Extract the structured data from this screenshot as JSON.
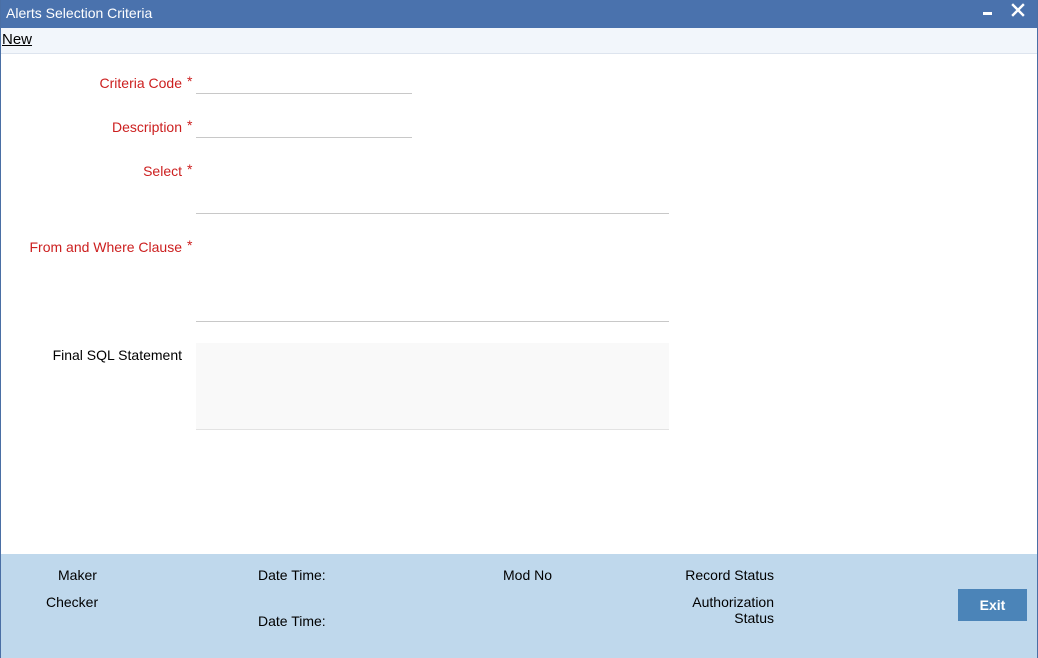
{
  "window": {
    "title": "Alerts Selection Criteria"
  },
  "toolbar": {
    "new_label": "New"
  },
  "form": {
    "criteria_code": {
      "label": "Criteria Code",
      "required_mark": "*",
      "value": ""
    },
    "description": {
      "label": "Description",
      "required_mark": "*",
      "value": ""
    },
    "select": {
      "label": "Select",
      "required_mark": "*",
      "value": ""
    },
    "from_where": {
      "label": "From and Where Clause",
      "required_mark": "*",
      "value": ""
    },
    "final_sql": {
      "label": "Final SQL Statement",
      "value": ""
    }
  },
  "footer": {
    "maker_label": "Maker",
    "checker_label": "Checker",
    "maker_datetime_label": "Date Time:",
    "checker_datetime_label": "Date Time:",
    "mod_no_label": "Mod No",
    "record_status_label": "Record Status",
    "authorization_status_line1": "Authorization",
    "authorization_status_line2": "Status",
    "exit_label": "Exit"
  },
  "colors": {
    "titlebar": "#4a72ad",
    "required_label": "#cc1f1f",
    "footer_bg": "#bfd8ec",
    "exit_button": "#4b84b8"
  }
}
